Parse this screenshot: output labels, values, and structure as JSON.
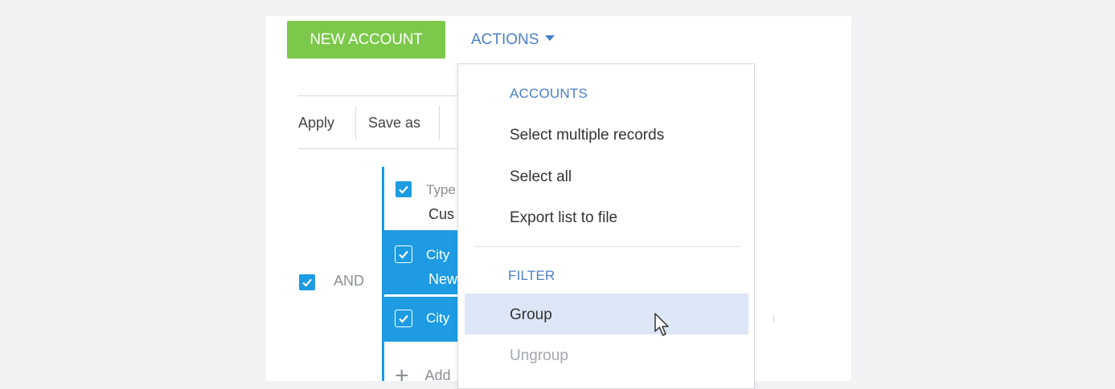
{
  "toolbar": {
    "new_account_label": "NEW ACCOUNT",
    "actions_label": "ACTIONS"
  },
  "filter_toolbar": {
    "apply_label": "Apply",
    "save_as_label": "Save as"
  },
  "filter_group": {
    "operator_label": "AND",
    "conditions": [
      {
        "line1": "Type",
        "line2": "Cus"
      },
      {
        "line1": "City",
        "line2": "New"
      },
      {
        "line1": "City",
        "line2": ""
      }
    ],
    "add_label": "Add"
  },
  "actions_menu": {
    "section_accounts": "ACCOUNTS",
    "select_multiple": "Select multiple records",
    "select_all": "Select all",
    "export": "Export list to file",
    "section_filter": "FILTER",
    "group": "Group",
    "ungroup": "Ungroup"
  },
  "colors": {
    "accent_green": "#7cc84a",
    "accent_blue": "#1d9be3",
    "link_blue": "#4a7fc8",
    "highlight": "#dde6f6"
  }
}
